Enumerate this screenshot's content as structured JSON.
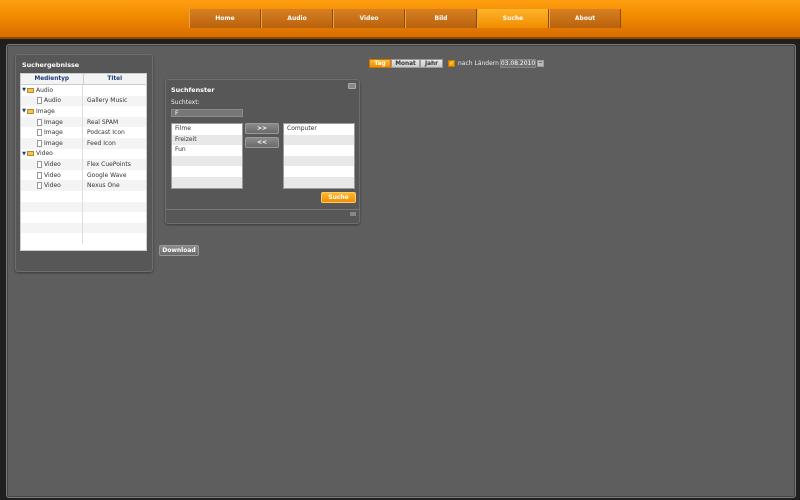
{
  "nav": {
    "items": [
      {
        "label": "Home",
        "active": false
      },
      {
        "label": "Audio",
        "active": false
      },
      {
        "label": "Video",
        "active": false
      },
      {
        "label": "Bild",
        "active": false
      },
      {
        "label": "Suche",
        "active": true
      },
      {
        "label": "About",
        "active": false
      }
    ]
  },
  "results": {
    "title": "Suchergebnisse",
    "col_type": "Medientyp",
    "col_title": "Titel",
    "rows": [
      {
        "kind": "group",
        "type": "Audio",
        "title": ""
      },
      {
        "kind": "item",
        "type": "Audio",
        "title": "Gallery Music"
      },
      {
        "kind": "group",
        "type": "Image",
        "title": ""
      },
      {
        "kind": "item",
        "type": "Image",
        "title": "Real SPAM"
      },
      {
        "kind": "item",
        "type": "Image",
        "title": "Podcast Icon"
      },
      {
        "kind": "item",
        "type": "Image",
        "title": "Feed Icon"
      },
      {
        "kind": "group",
        "type": "Video",
        "title": ""
      },
      {
        "kind": "item",
        "type": "Video",
        "title": "Flex CuePoints"
      },
      {
        "kind": "item",
        "type": "Video",
        "title": "Google Wave"
      },
      {
        "kind": "item",
        "type": "Video",
        "title": "Nexus One"
      }
    ]
  },
  "toolbar": {
    "day": "Tag",
    "month": "Monat",
    "year": "Jahr",
    "country_label": "nach Ländern",
    "date": "03.08.2010"
  },
  "search": {
    "title": "Suchfenster",
    "text_label": "Suchtext:",
    "input_value": "F",
    "left_list": [
      "Filme",
      "Freizeit",
      "Fun"
    ],
    "right_list": [
      "Computer"
    ],
    "add_label": ">>",
    "remove_label": "<<",
    "search_label": "Suche"
  },
  "download_label": "Download",
  "colors": {
    "accent": "#f28c00",
    "panel": "#5e5e5e",
    "link": "#1d3a78"
  }
}
